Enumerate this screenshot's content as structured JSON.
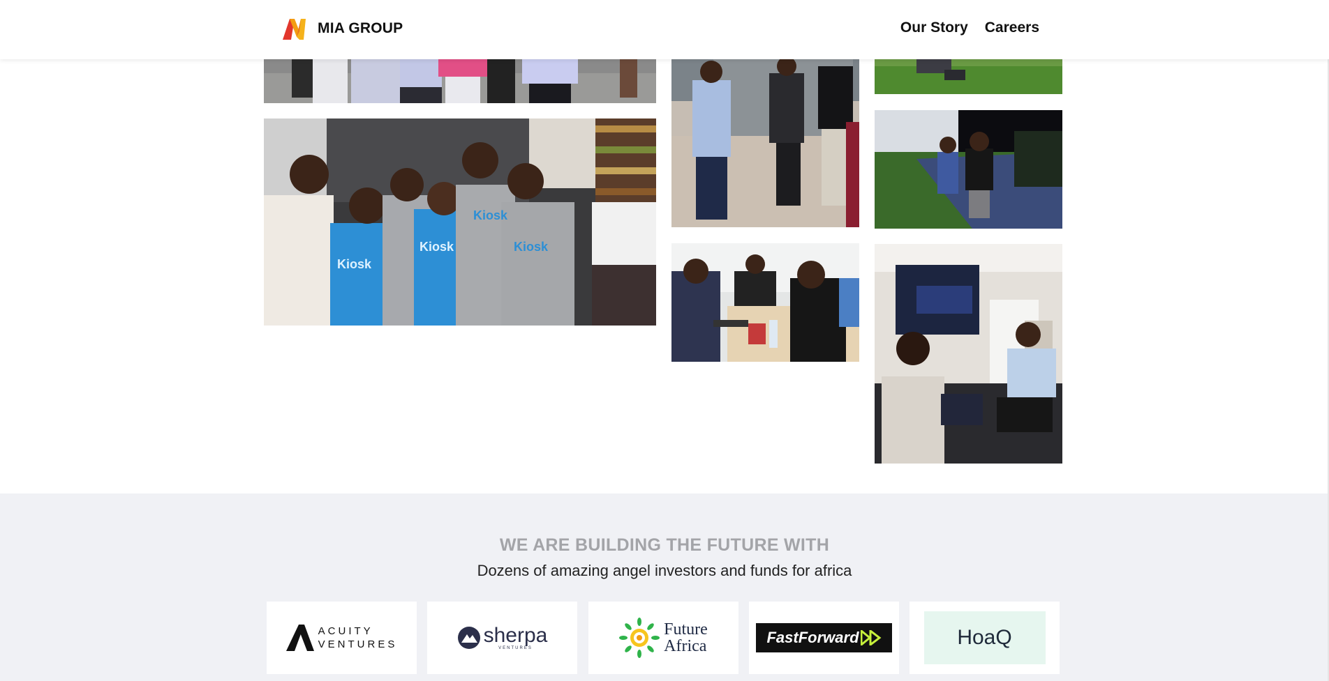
{
  "header": {
    "brand": "MIA GROUP",
    "nav": [
      "Our Story",
      "Careers"
    ]
  },
  "colors": {
    "logo_orange": "#f39c12",
    "logo_red": "#e2362c",
    "section_bg": "#f0f1f5",
    "heading_grey": "#a3a4a8"
  },
  "gallery": {
    "photos": [
      "team-outdoor-top-photo",
      "kiosk-team-photo",
      "team-parking-lot-photo",
      "meeting-room-photo",
      "lawn-top-photo",
      "night-dance-photo",
      "presentation-screen-photo"
    ]
  },
  "investors": {
    "heading": "WE ARE BUILDING THE FUTURE WITH",
    "subheading": "Dozens of amazing angel investors and funds for africa",
    "logos": {
      "acuity_line1": "ACUITY",
      "acuity_line2": "VENTURES",
      "sherpa_name": "sherpa",
      "sherpa_sub": "VENTURES",
      "future_line1": "Future",
      "future_line2": "Africa",
      "fastforward": "FastForward",
      "hoaq": "HoaQ"
    }
  }
}
